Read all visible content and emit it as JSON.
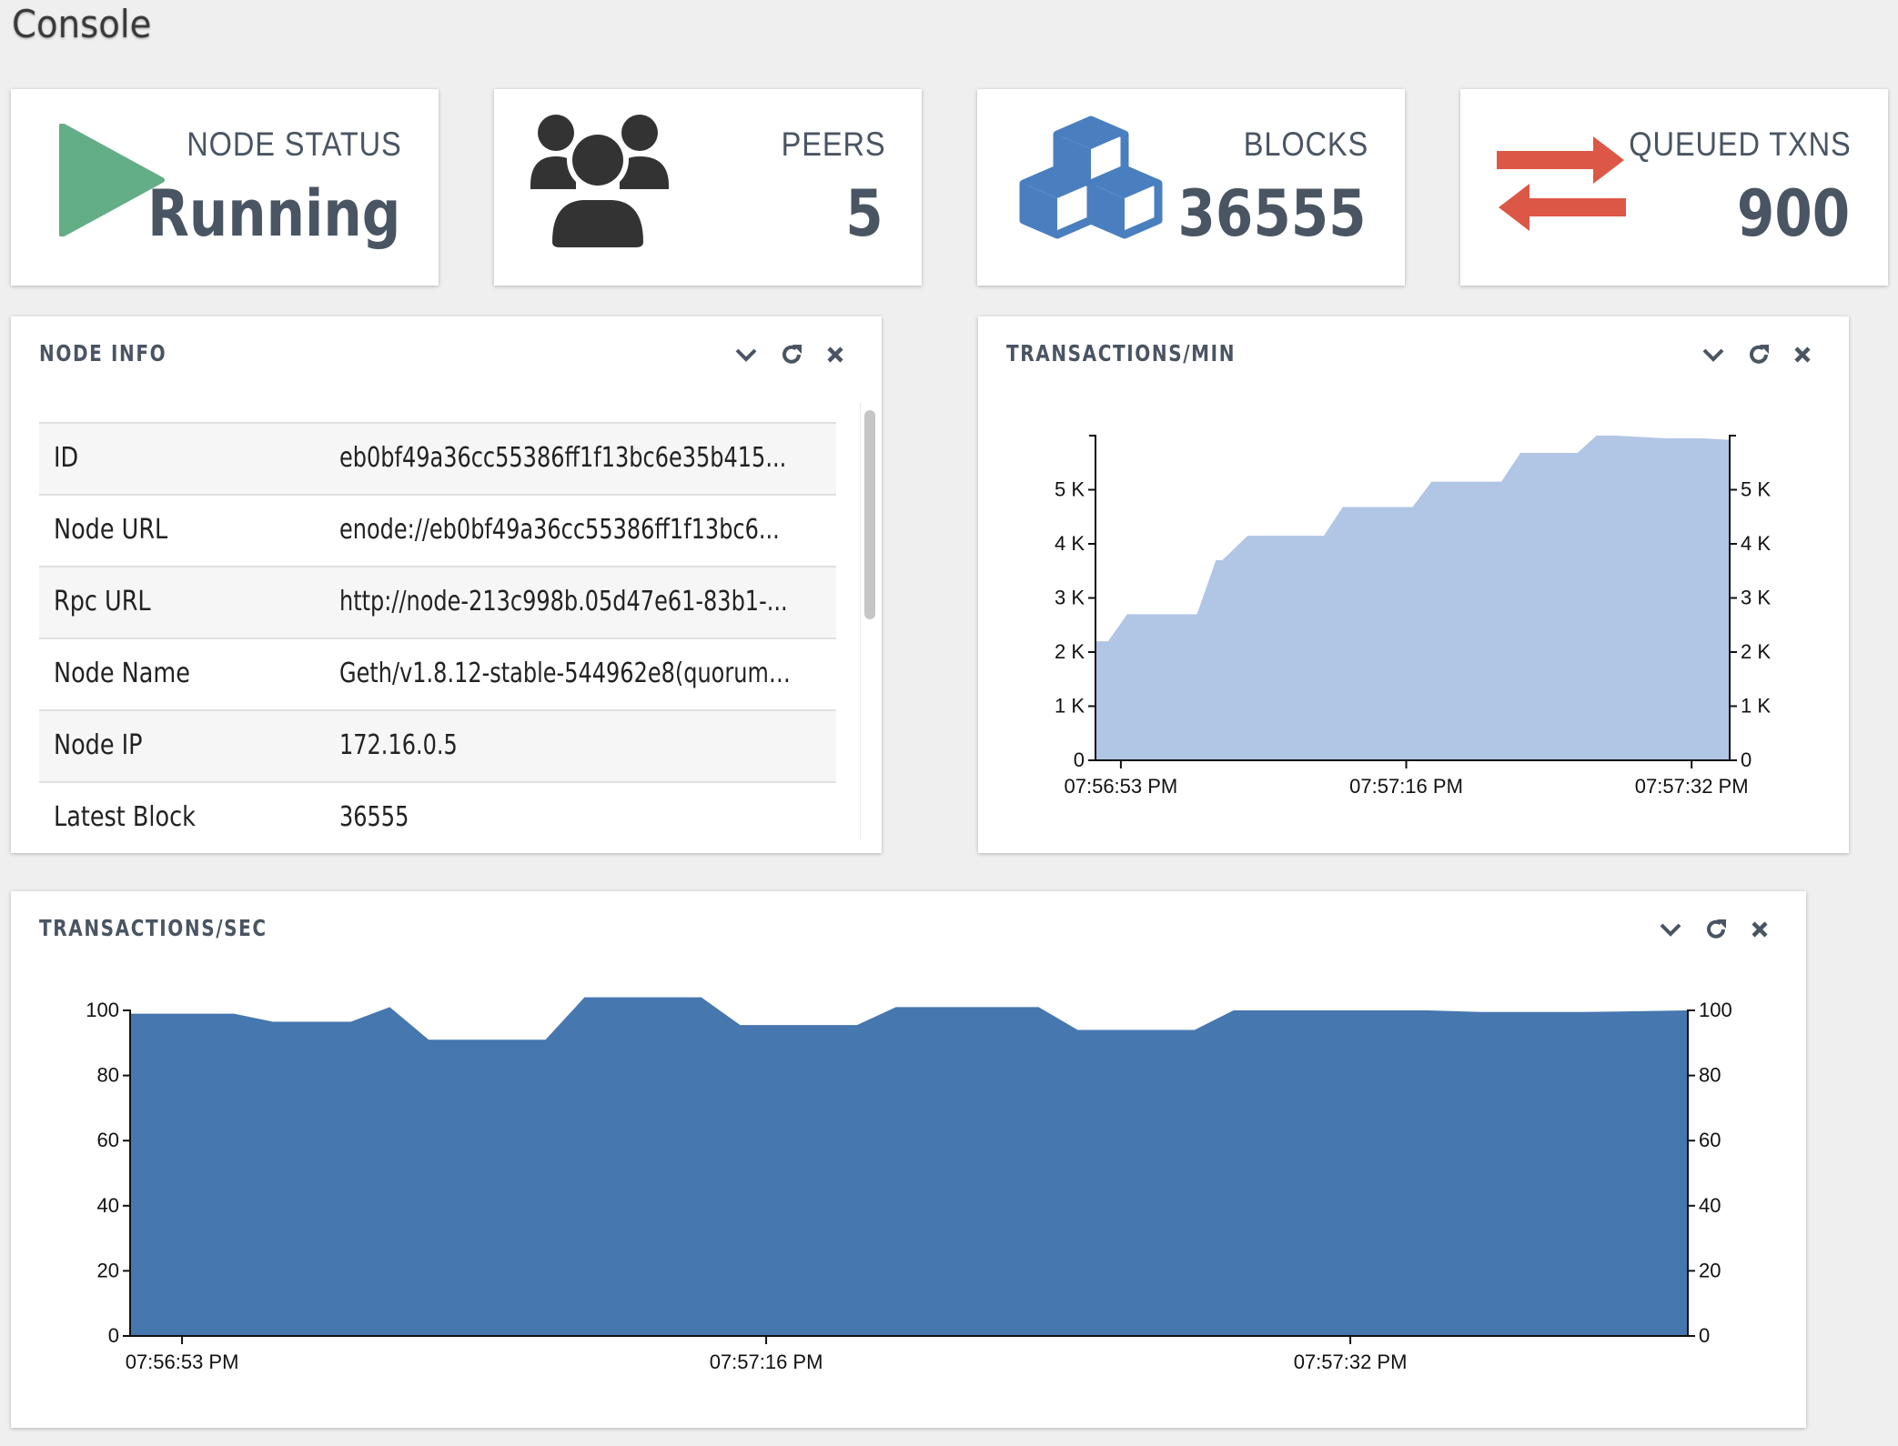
{
  "page": {
    "title": "Console"
  },
  "stats": [
    {
      "label": "NODE STATUS",
      "value": "Running",
      "icon": "play-icon",
      "color": "#63ad87"
    },
    {
      "label": "PEERS",
      "value": "5",
      "icon": "users-icon",
      "color": "#333333"
    },
    {
      "label": "BLOCKS",
      "value": "36555",
      "icon": "cubes-icon",
      "color": "#4a7fbf"
    },
    {
      "label": "QUEUED TXNS",
      "value": "900",
      "icon": "exchange-icon",
      "color": "#dd5747"
    }
  ],
  "node_info": {
    "title": "NODE INFO",
    "rows": [
      {
        "key": "ID",
        "value": "eb0bf49a36cc55386ff1f13bc6e35b415..."
      },
      {
        "key": "Node URL",
        "value": "enode://eb0bf49a36cc55386ff1f13bc6..."
      },
      {
        "key": "Rpc URL",
        "value": "http://node-213c998b.05d47e61-83b1-..."
      },
      {
        "key": "Node Name",
        "value": "Geth/v1.8.12-stable-544962e8(quorum-..."
      },
      {
        "key": "Node IP",
        "value": "172.16.0.5"
      },
      {
        "key": "Latest Block",
        "value": "36555"
      }
    ]
  },
  "txn_min": {
    "title": "TRANSACTIONS/MIN"
  },
  "txn_sec": {
    "title": "TRANSACTIONS/SEC"
  },
  "chart_data": [
    {
      "type": "area",
      "title": "TRANSACTIONS/MIN",
      "color": "#b1c6e4",
      "xlabel": "",
      "ylabel": "",
      "ylim": [
        0,
        6000
      ],
      "y_ticks": [
        "0",
        "1 K",
        "2 K",
        "3 K",
        "4 K",
        "5 K"
      ],
      "y_tick_values": [
        0,
        1000,
        2000,
        3000,
        4000,
        5000
      ],
      "x_ticks": [
        "07:56:53 PM",
        "07:57:16 PM",
        "07:57:32 PM"
      ],
      "x_tick_values": [
        2,
        24.5,
        47
      ],
      "x": [
        0,
        1,
        2.5,
        8,
        9.5,
        10,
        12,
        18,
        19.5,
        25,
        26.5,
        32,
        33.5,
        38,
        39.5,
        41,
        45,
        48,
        50
      ],
      "values": [
        2200,
        2200,
        2700,
        2700,
        3700,
        3700,
        4150,
        4150,
        4680,
        4680,
        5150,
        5150,
        5680,
        5680,
        6000,
        6000,
        5950,
        5950,
        5920
      ]
    },
    {
      "type": "area",
      "title": "TRANSACTIONS/SEC",
      "color": "#4677af",
      "xlabel": "",
      "ylabel": "",
      "ylim": [
        0,
        100
      ],
      "y_ticks": [
        "0",
        "20",
        "40",
        "60",
        "80",
        "100"
      ],
      "y_tick_values": [
        0,
        20,
        40,
        60,
        80,
        100
      ],
      "x_ticks": [
        "07:56:53 PM",
        "07:57:16 PM",
        "07:57:32 PM"
      ],
      "x_tick_values": [
        2,
        24.5,
        47
      ],
      "x": [
        0,
        4,
        5.5,
        8.5,
        10,
        11.5,
        16,
        17.5,
        22,
        23.5,
        28,
        29.5,
        35,
        36.5,
        41,
        42.5,
        50,
        52,
        56,
        60
      ],
      "values": [
        99,
        99,
        96.5,
        96.5,
        101,
        91,
        91,
        104,
        104,
        95.5,
        95.5,
        101,
        101,
        94,
        94,
        100,
        100,
        99.5,
        99.5,
        100
      ]
    }
  ]
}
